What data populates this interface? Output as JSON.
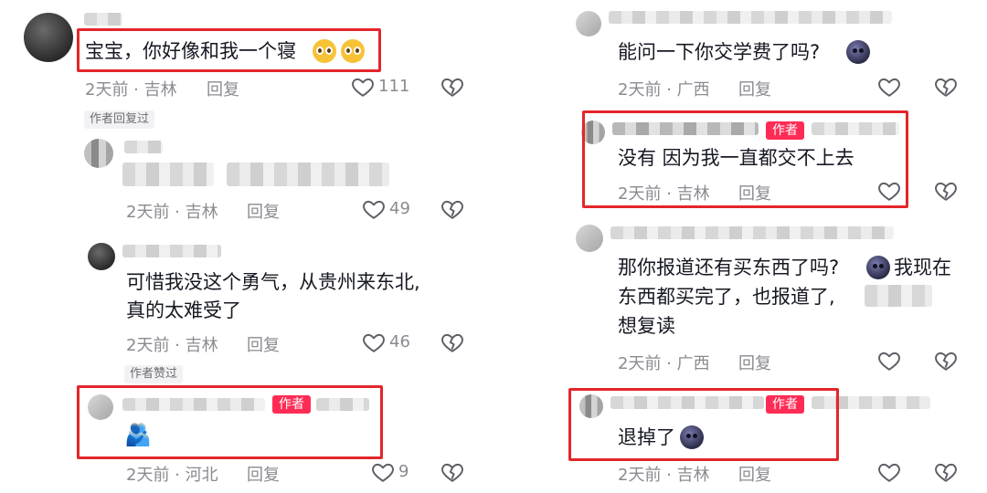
{
  "left": {
    "c1": {
      "text": "宝宝，你好像和我一个寝",
      "time": "2天前 · 吉林",
      "reply": "回复",
      "likes": "111"
    },
    "author_replied_tag": "作者回复过",
    "c2": {
      "time": "2天前 · 吉林",
      "reply": "回复",
      "likes": "49"
    },
    "c3": {
      "line1": "可惜我没这个勇气，从贵州来东北,",
      "line2": "真的太难受了",
      "time": "2天前 · 吉林",
      "reply": "回复",
      "likes": "46"
    },
    "author_liked_tag": "作者赞过",
    "c4": {
      "badge": "作者",
      "time": "2天前 · 河北",
      "reply": "回复",
      "likes": "9"
    }
  },
  "right": {
    "c1": {
      "text": "能问一下你交学费了吗?",
      "time": "2天前 · 广西",
      "reply": "回复"
    },
    "c2": {
      "badge": "作者",
      "text": "没有 因为我一直都交不上去",
      "time": "2天前 · 吉林",
      "reply": "回复"
    },
    "c3": {
      "line1a": "那你报道还有买东西了吗?",
      "line1b": "我现在",
      "line2": "东西都买完了，也报道了,",
      "line3": "想复读",
      "time": "2天前 · 广西",
      "reply": "回复"
    },
    "c4": {
      "badge": "作者",
      "text": "退掉了",
      "time": "2天前 · 吉林",
      "reply": "回复"
    }
  },
  "colors": {
    "accent": "#fe2c55",
    "highlight": "#e3262b",
    "meta": "#8a8b91",
    "text": "#161823"
  },
  "icons": [
    "heart-icon",
    "broken-heart-icon",
    "emoji-face-icon",
    "emoji-pleading-icon",
    "emoji-hug-icon"
  ]
}
